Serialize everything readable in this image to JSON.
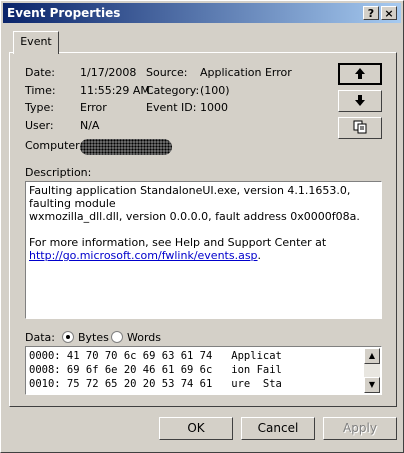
{
  "window": {
    "title": "Event Properties",
    "help_label": "?",
    "close_label": "×"
  },
  "tabs": [
    {
      "label": "Event"
    }
  ],
  "fields": {
    "date_label": "Date:",
    "date_value": "1/17/2008",
    "time_label": "Time:",
    "time_value": "11:55:29 AM",
    "type_label": "Type:",
    "type_value": "Error",
    "user_label": "User:",
    "user_value": "N/A",
    "computer_label": "Computer:",
    "source_label": "Source:",
    "source_value": "Application Error",
    "category_label": "Category:",
    "category_value": "(100)",
    "eventid_label": "Event ID:",
    "eventid_value": "1000"
  },
  "description": {
    "label": "Description:",
    "line1": "Faulting application StandaloneUI.exe, version 4.1.1653.0, faulting module",
    "line2": "wxmozilla_dll.dll, version 0.0.0.0, fault address 0x0000f08a.",
    "line3": "For more information, see Help and Support Center at",
    "link": "http://go.microsoft.com/fwlink/events.asp",
    "after_link": "."
  },
  "data": {
    "label": "Data:",
    "bytes_label": "Bytes",
    "words_label": "Words",
    "selected": "Bytes",
    "lines": [
      "0000: 41 70 70 6c 69 63 61 74   Applicat",
      "0008: 69 6f 6e 20 46 61 69 6c   ion Fail",
      "0010: 75 72 65 20 20 53 74 61   ure  Sta"
    ]
  },
  "nav": {
    "up_icon": "arrow-up-icon",
    "down_icon": "arrow-down-icon",
    "copy_icon": "copy-icon"
  },
  "footer": {
    "ok_label": "OK",
    "cancel_label": "Cancel",
    "apply_label": "Apply"
  }
}
